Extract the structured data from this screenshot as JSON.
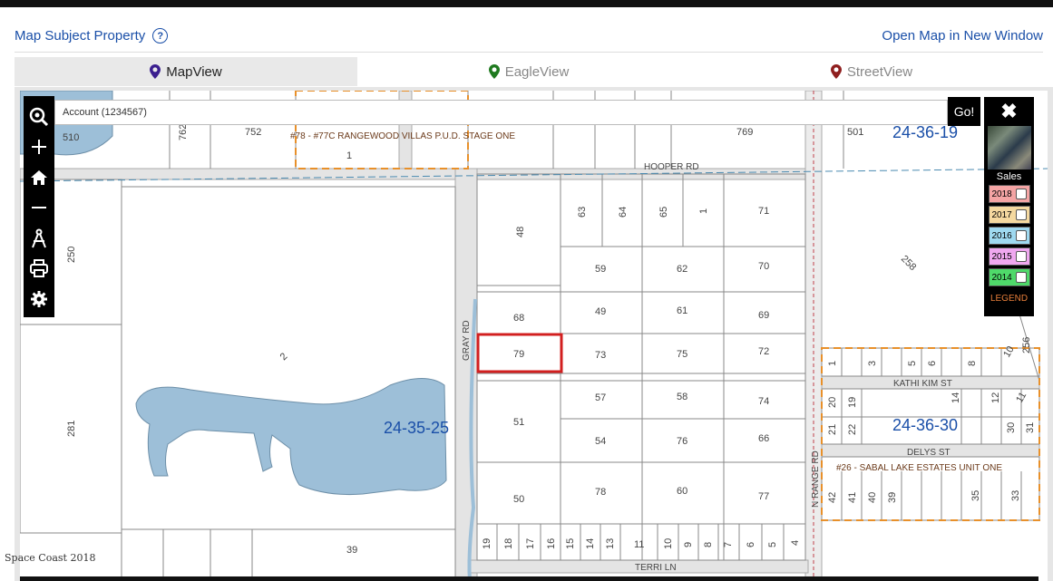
{
  "header": {
    "title": "Map Subject Property",
    "help_icon": "?",
    "open_link": "Open Map in New Window"
  },
  "tabs": [
    {
      "label": "MapView",
      "icon": "map-pin-icon",
      "color": "#3b1f8f",
      "active": true
    },
    {
      "label": "EagleView",
      "icon": "map-pin-icon",
      "color": "#1f7a1f",
      "active": false
    },
    {
      "label": "StreetView",
      "icon": "map-pin-icon",
      "color": "#8f1f1f",
      "active": false
    }
  ],
  "toolbar": {
    "items": [
      "search-zoom-icon",
      "zoom-in-icon",
      "home-icon",
      "zoom-out-icon",
      "measure-icon",
      "print-icon",
      "settings-icon"
    ]
  },
  "search": {
    "value": "Account (1234567)",
    "go_label": "Go!"
  },
  "side_panel": {
    "close_icon": "✖",
    "sales_label": "Sales",
    "years": [
      {
        "year": "2018",
        "color": "#f4a4a4"
      },
      {
        "year": "2017",
        "color": "#f5d9a0"
      },
      {
        "year": "2016",
        "color": "#9fd9f0"
      },
      {
        "year": "2015",
        "color": "#f0a8f0"
      },
      {
        "year": "2014",
        "color": "#4fd96a"
      }
    ],
    "legend_label": "LEGEND"
  },
  "map": {
    "sections": [
      "24-36-19",
      "24-35-25",
      "24-36-30"
    ],
    "roads": [
      "HOOPER RD",
      "GRAY RD",
      "N RANGE RD",
      "KATHI KIM ST",
      "DELYS ST",
      "TERRI LN"
    ],
    "subdivisions": [
      "#78 - #77C RANGEWOOD VILLAS P.U.D. STAGE ONE",
      "#26 - SABAL LAKE ESTATES UNIT ONE"
    ],
    "parcels": [
      "510",
      "762",
      "752",
      "1",
      "769",
      "501",
      "250",
      "2",
      "281",
      "39",
      "48",
      "63",
      "64",
      "65",
      "1",
      "71",
      "59",
      "62",
      "70",
      "68",
      "49",
      "61",
      "69",
      "79",
      "73",
      "75",
      "72",
      "57",
      "58",
      "74",
      "51",
      "54",
      "76",
      "66",
      "50",
      "78",
      "60",
      "77",
      "19",
      "18",
      "17",
      "16",
      "15",
      "14",
      "13",
      "11",
      "10",
      "9",
      "8",
      "7",
      "6",
      "5",
      "4",
      "258",
      "1",
      "3",
      "5",
      "6",
      "8",
      "10",
      "256",
      "20",
      "19",
      "14",
      "12",
      "11",
      "21",
      "22",
      "30",
      "31",
      "42",
      "41",
      "40",
      "39",
      "35",
      "33"
    ],
    "credit": "Space Coast 2018"
  }
}
